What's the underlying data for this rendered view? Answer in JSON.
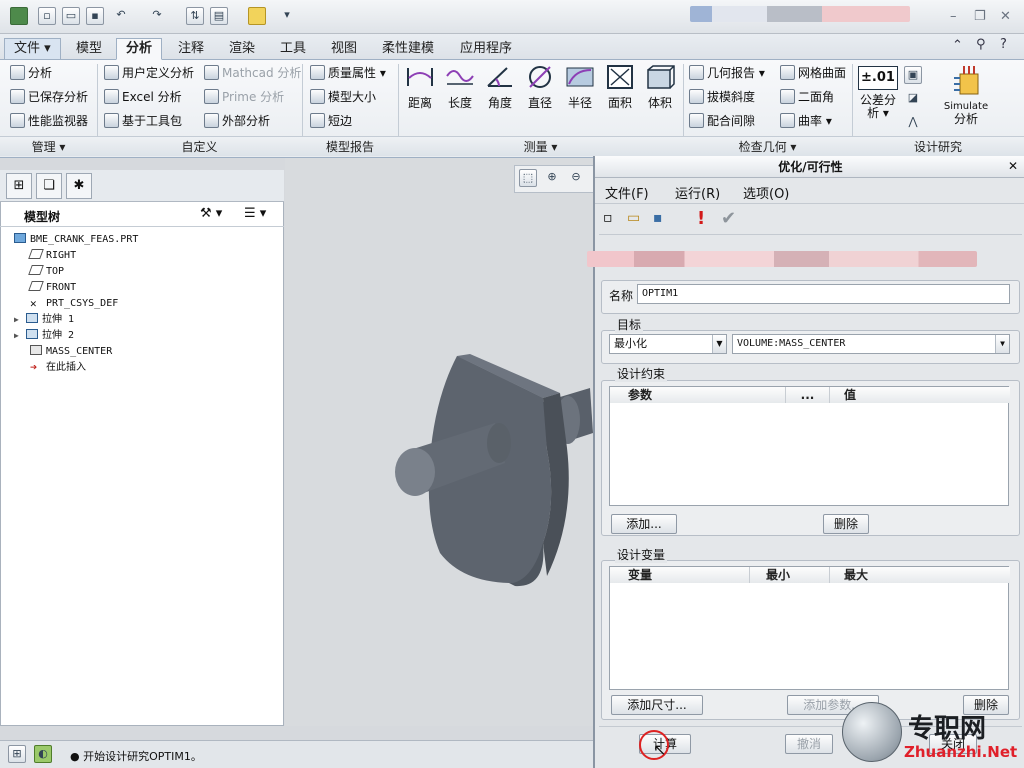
{
  "tabs": {
    "file": "文件",
    "items": [
      "模型",
      "分析",
      "注释",
      "渲染",
      "工具",
      "视图",
      "柔性建模",
      "应用程序"
    ],
    "active": "分析"
  },
  "ribbon": {
    "manage": [
      "分析",
      "已保存分析",
      "性能监视器"
    ],
    "custom_col1": [
      "用户定义分析",
      "Excel 分析",
      "基于工具包"
    ],
    "custom_col2": [
      "Mathcad 分析",
      "Prime 分析",
      "外部分析"
    ],
    "model_report": [
      "质量属性",
      "模型大小",
      "短边"
    ],
    "measure": [
      "距离",
      "长度",
      "角度",
      "直径",
      "半径",
      "面积",
      "体积"
    ],
    "inspect_col1": [
      "几何报告",
      "拔模斜度",
      "配合间隙"
    ],
    "inspect_col2": [
      "网格曲面",
      "二面角",
      "曲率"
    ],
    "design_study": {
      "tolerance": "公差分析",
      "tolerance_l1": "公差分",
      "tolerance_l2": "析",
      "tolerance_value": "±.01",
      "simulate_l1": "Simulate",
      "simulate_l2": "分析"
    },
    "groups": {
      "manage": "管理",
      "custom": "自定义",
      "model_report": "模型报告",
      "measure": "测量",
      "inspect": "检查几何",
      "design": "设计研究"
    }
  },
  "tree": {
    "title": "模型树",
    "items": [
      {
        "label": "BME_CRANK_FEAS.PRT"
      },
      {
        "label": "RIGHT"
      },
      {
        "label": "TOP"
      },
      {
        "label": "FRONT"
      },
      {
        "label": "PRT_CSYS_DEF"
      },
      {
        "label": "拉伸 1"
      },
      {
        "label": "拉伸 2"
      },
      {
        "label": "MASS_CENTER"
      },
      {
        "label": "在此插入"
      }
    ]
  },
  "status": {
    "message": "开始设计研究OPTIM1。"
  },
  "dialog": {
    "title": "优化/可行性",
    "menu": [
      "文件(F)",
      "运行(R)",
      "选项(O)"
    ],
    "name_label": "名称",
    "name_value": "OPTIM1",
    "goal_label": "目标",
    "goal_mode": "最小化",
    "goal_param": "VOLUME:MASS_CENTER",
    "constraints_label": "设计约束",
    "constraints_cols": [
      "参数",
      "...",
      "值"
    ],
    "add_button": "添加...",
    "delete_button": "删除",
    "variables_label": "设计变量",
    "variables_cols": [
      "变量",
      "最小",
      "最大"
    ],
    "add_dim_button": "添加尺寸...",
    "add_param_button": "添加参数...",
    "delete_var_button": "删除",
    "compute_button": "计算",
    "undo_button": "撤消",
    "close_button": "关闭"
  },
  "watermark": {
    "brand": "专职网",
    "url": "Zhuanzhi.Net"
  },
  "colors": {
    "accent": "#3a6ea5",
    "part": "#59606a"
  }
}
